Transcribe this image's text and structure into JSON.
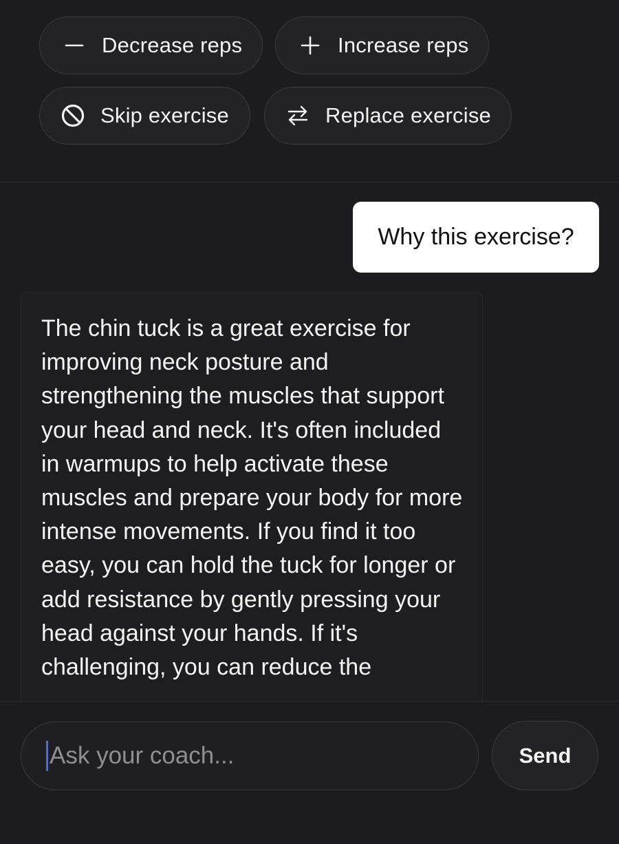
{
  "quick_actions": {
    "decrease_label": "Decrease reps",
    "increase_label": "Increase reps",
    "skip_label": "Skip exercise",
    "replace_label": "Replace exercise"
  },
  "chat": {
    "user_message": "Why this exercise?",
    "assistant_message": "The chin tuck is a great exercise for improving neck posture and strengthening the muscles that support your head and neck. It's often included in warmups to help activate these muscles and prepare your body for more intense movements. If you find it too easy, you can hold the tuck for longer or add resistance by gently pressing your head against your hands. If it's challenging, you can reduce the"
  },
  "composer": {
    "placeholder": "Ask your coach...",
    "send_label": "Send"
  },
  "colors": {
    "background": "#1c1c1e",
    "chip_background": "#232325",
    "user_bubble": "#ffffff",
    "caret": "#4a6cf7"
  }
}
